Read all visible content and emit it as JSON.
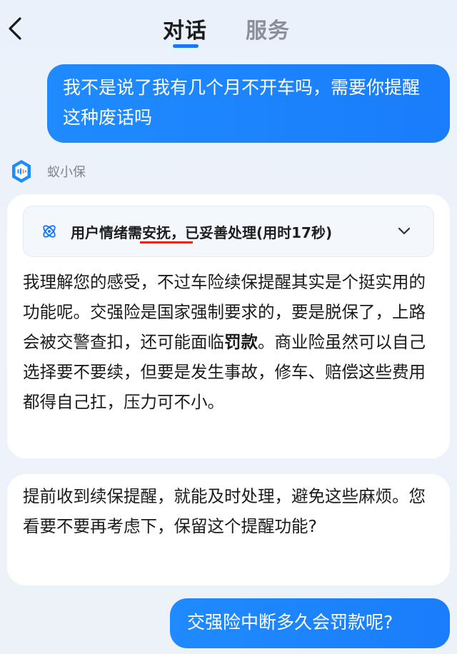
{
  "header": {
    "tabs": [
      {
        "label": "对话",
        "active": true
      },
      {
        "label": "服务",
        "active": false
      }
    ],
    "accent_color": "#1677ff"
  },
  "messages": {
    "user_1": "我不是说了我有几个月不开车吗，需要你提醒这种废话吗",
    "bot_name": "蚁小保",
    "status": "用户情绪需安抚，已妥善处理(用时17秒)",
    "reply_1": {
      "before_bold": "我理解您的感受，不过车险续保提醒其实是个挺实用的功能呢。交强险是国家强制要求的，要是脱保了，上路会被交警查扣，还可能面临",
      "bold": "罚款",
      "after_bold": "。商业险虽然可以自己选择要不要续，但要是发生事故，修车、赔偿这些费用都得自己扛，压力可不小。"
    },
    "reply_2": "提前收到续保提醒，就能及时处理，避免这些麻烦。您看要不要再考虑下，保留这个提醒功能?",
    "user_2": "交强险中断多久会罚款呢?"
  }
}
